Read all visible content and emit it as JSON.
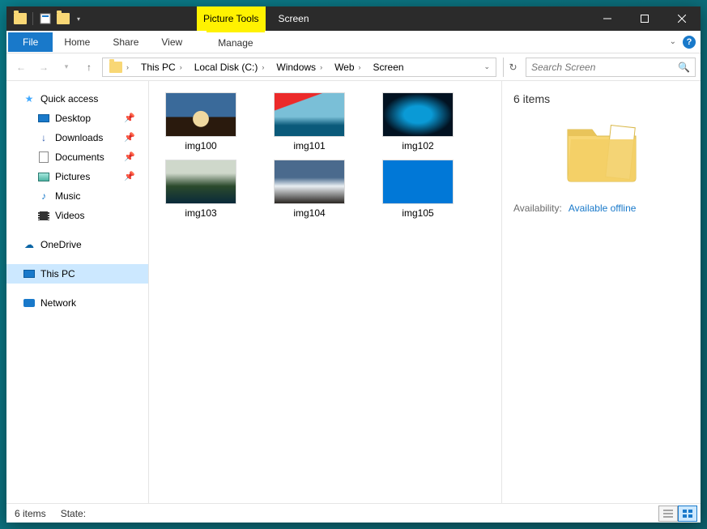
{
  "titlebar": {
    "context_tab": "Picture Tools",
    "title": "Screen"
  },
  "ribbon": {
    "file": "File",
    "tabs": [
      "Home",
      "Share",
      "View"
    ],
    "contextual": "Manage"
  },
  "breadcrumb": {
    "segments": [
      "This PC",
      "Local Disk (C:)",
      "Windows",
      "Web",
      "Screen"
    ]
  },
  "search": {
    "placeholder": "Search Screen"
  },
  "nav": {
    "quick_access": "Quick access",
    "items": [
      {
        "label": "Desktop",
        "pinned": true
      },
      {
        "label": "Downloads",
        "pinned": true
      },
      {
        "label": "Documents",
        "pinned": true
      },
      {
        "label": "Pictures",
        "pinned": true
      },
      {
        "label": "Music",
        "pinned": false
      },
      {
        "label": "Videos",
        "pinned": false
      }
    ],
    "onedrive": "OneDrive",
    "this_pc": "This PC",
    "network": "Network"
  },
  "items": [
    {
      "name": "img100"
    },
    {
      "name": "img101"
    },
    {
      "name": "img102"
    },
    {
      "name": "img103"
    },
    {
      "name": "img104"
    },
    {
      "name": "img105"
    }
  ],
  "details": {
    "title": "6 items",
    "availability_label": "Availability:",
    "availability_value": "Available offline"
  },
  "status": {
    "count": "6 items",
    "state_label": "State:"
  }
}
